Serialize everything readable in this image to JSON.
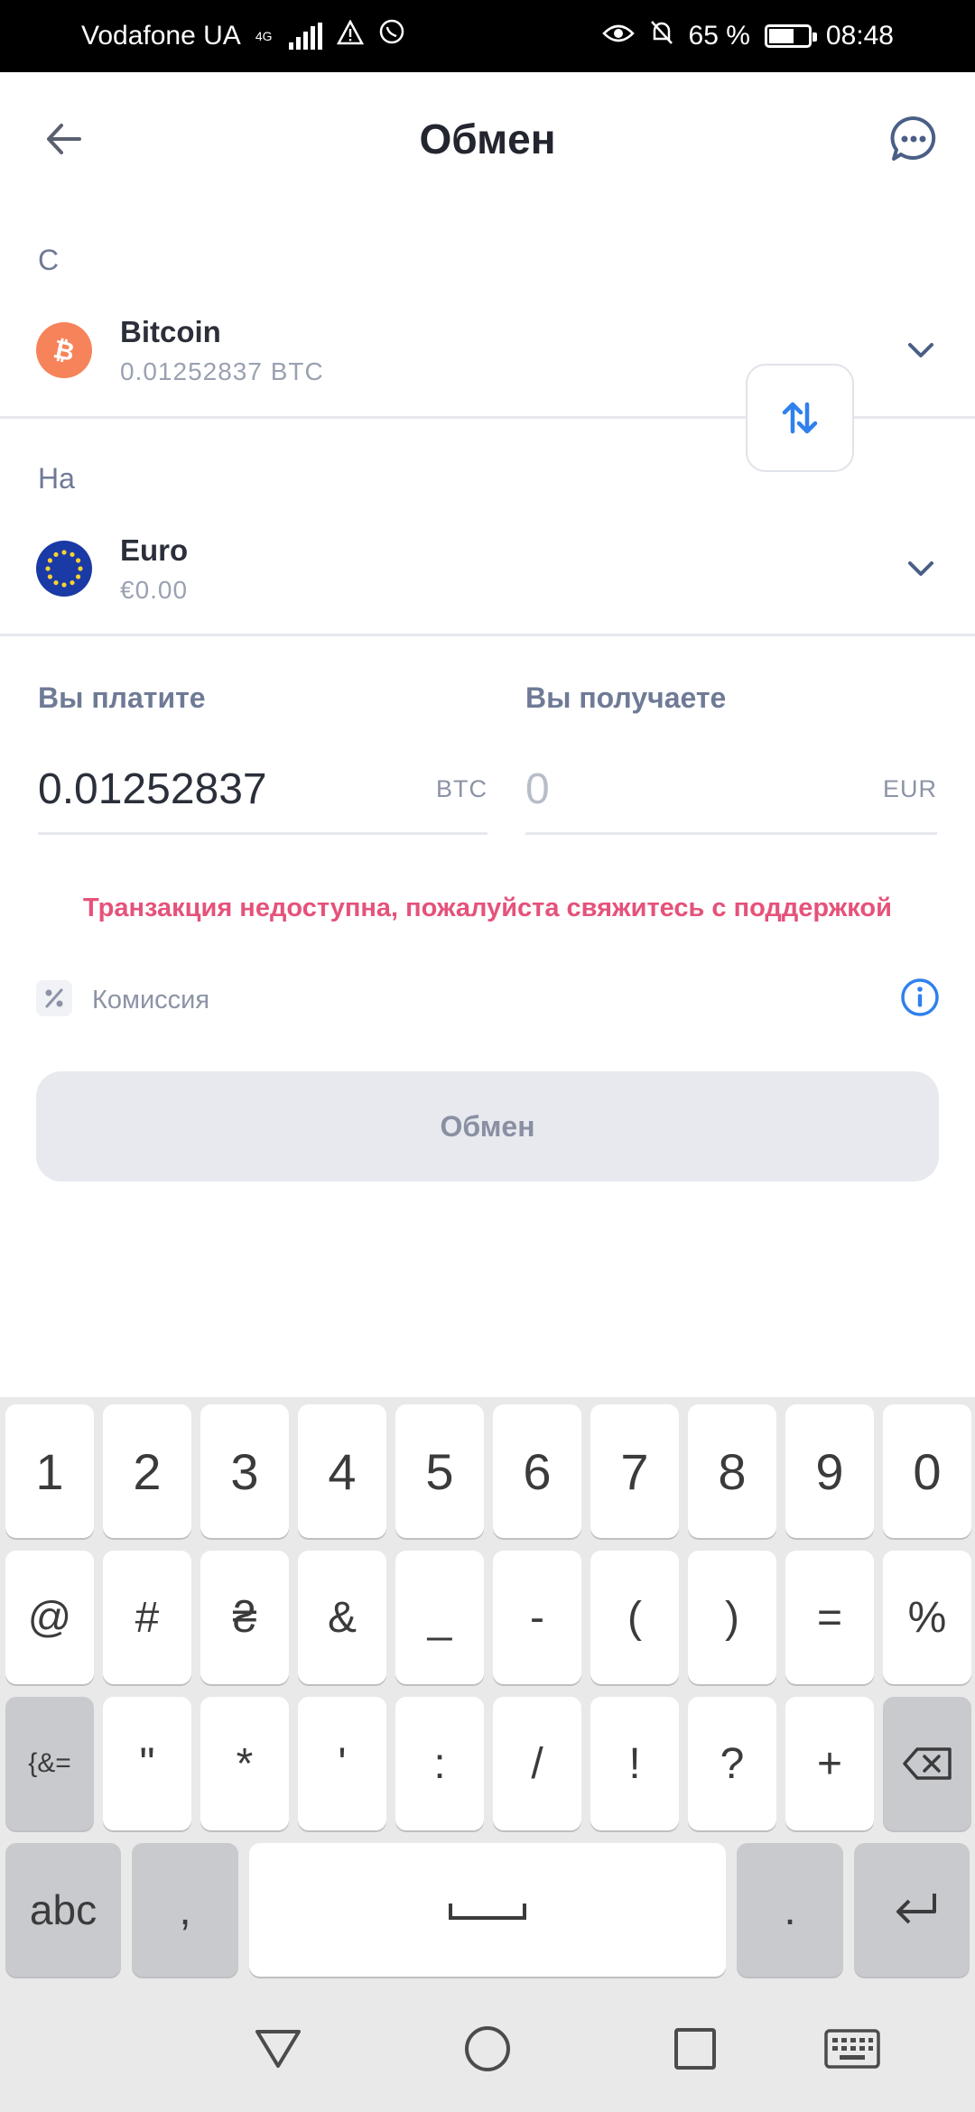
{
  "status_bar": {
    "carrier": "Vodafone UA",
    "network": "4G",
    "battery": "65 %",
    "battery_level": 0.65,
    "time": "08:48"
  },
  "header": {
    "title": "Обмен"
  },
  "from": {
    "label": "С",
    "currency_name": "Bitcoin",
    "balance": "0.01252837 BTC",
    "icon": "bitcoin-icon",
    "icon_color": "#f7835a"
  },
  "to": {
    "label": "На",
    "currency_name": "Euro",
    "balance": "€0.00",
    "icon": "eu-flag-icon",
    "icon_color": "#1a3aa5"
  },
  "pay": {
    "label": "Вы платите",
    "value": "0.01252837",
    "unit": "BTC"
  },
  "receive": {
    "label": "Вы получаете",
    "placeholder": "0",
    "unit": "EUR"
  },
  "error_message": "Транзакция недоступна, пожалуйста свяжитесь с поддержкой",
  "fee": {
    "label": "Комиссия"
  },
  "exchange_button": "Обмен",
  "colors": {
    "accent": "#2f80ed",
    "error": "#e5527a",
    "disabled_button": "#e7e9ef"
  },
  "keyboard": {
    "row1": [
      "1",
      "2",
      "3",
      "4",
      "5",
      "6",
      "7",
      "8",
      "9",
      "0"
    ],
    "row2": [
      "@",
      "#",
      "₴",
      "&",
      "_",
      "-",
      "(",
      ")",
      "=",
      "%"
    ],
    "row3": [
      "{&=",
      "\"",
      "*",
      "'",
      ":",
      "/",
      "!",
      "?",
      "+"
    ],
    "row4": [
      "abc",
      ",",
      "."
    ]
  }
}
